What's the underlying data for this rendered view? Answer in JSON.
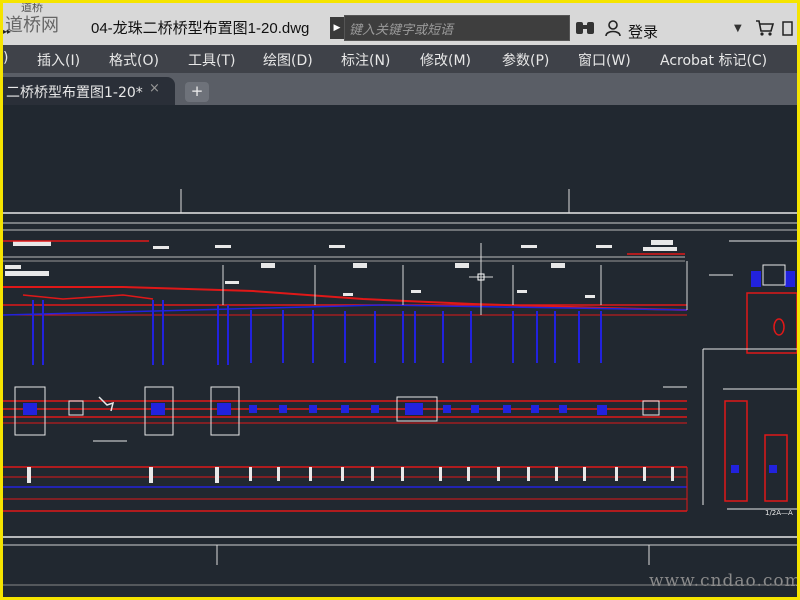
{
  "app": {
    "logo_line1": "道桥",
    "logo_line2": "道桥网",
    "file_title": "04-龙珠二桥桥型布置图1-20.dwg"
  },
  "search": {
    "placeholder": "键入关键字或短语"
  },
  "account": {
    "login_label": "登录"
  },
  "icons": {
    "search_arrow": "play-right-icon",
    "binoculars": "binoculars-icon",
    "user": "user-icon",
    "dropdown": "chevron-down-icon",
    "cart": "cart-icon",
    "expand": "nav-arrows-icon"
  },
  "menubar": {
    "items": [
      {
        "label": ")"
      },
      {
        "label": "插入(I)"
      },
      {
        "label": "格式(O)"
      },
      {
        "label": "工具(T)"
      },
      {
        "label": "绘图(D)"
      },
      {
        "label": "标注(N)"
      },
      {
        "label": "修改(M)"
      },
      {
        "label": "参数(P)"
      },
      {
        "label": "窗口(W)"
      },
      {
        "label": "Acrobat 标记(C)"
      }
    ]
  },
  "tabs": {
    "active_label": "二桥桥型布置图1-20*",
    "close_symbol": "×",
    "add_symbol": "+"
  },
  "drawing": {
    "section_label": "1/2A—A",
    "watermark": "www.cndao.com"
  },
  "colors": {
    "canvas_bg": "#212830",
    "frame_border": "#f5e400",
    "red_line": "#e01818",
    "blue_line": "#2222dd",
    "white_line": "#e8e8e8"
  }
}
